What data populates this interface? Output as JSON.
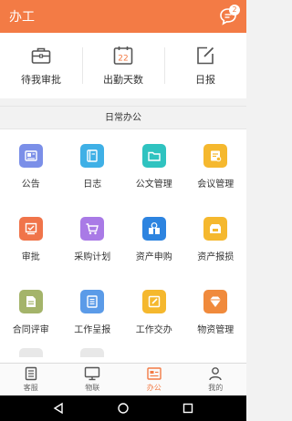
{
  "header": {
    "title": "办工",
    "chat_badge": "2",
    "color": "#f37b45"
  },
  "quick": [
    {
      "label": "待我审批",
      "icon": "briefcase-icon"
    },
    {
      "label": "出勤天数",
      "icon": "calendar-icon",
      "day": "22"
    },
    {
      "label": "日报",
      "icon": "edit-icon"
    }
  ],
  "section": {
    "title": "日常办公"
  },
  "grid": [
    {
      "label": "公告",
      "icon": "announcement-icon",
      "color": "#7b8fe8"
    },
    {
      "label": "日志",
      "icon": "journal-icon",
      "color": "#3fb0e6"
    },
    {
      "label": "公文管理",
      "icon": "folder-icon",
      "color": "#2fc3c0"
    },
    {
      "label": "会议管理",
      "icon": "meeting-icon",
      "color": "#f5b82e"
    },
    {
      "label": "审批",
      "icon": "approve-icon",
      "color": "#f0744a"
    },
    {
      "label": "采购计划",
      "icon": "cart-icon",
      "color": "#a97ae6"
    },
    {
      "label": "资产申购",
      "icon": "asset-purchase-icon",
      "color": "#2d84e0"
    },
    {
      "label": "资产报损",
      "icon": "asset-loss-icon",
      "color": "#f5b82e"
    },
    {
      "label": "合同评审",
      "icon": "contract-icon",
      "color": "#a4b46a"
    },
    {
      "label": "工作呈报",
      "icon": "report-icon",
      "color": "#5b9be8"
    },
    {
      "label": "工作交办",
      "icon": "assign-icon",
      "color": "#f5b82e"
    },
    {
      "label": "物资管理",
      "icon": "materials-icon",
      "color": "#f08a3c"
    }
  ],
  "grid_partial": [
    {
      "color": "#e8e8e8"
    },
    {
      "color": "#e8e8e8"
    }
  ],
  "tabs": [
    {
      "label": "客服",
      "icon": "customer-service-icon",
      "active": false
    },
    {
      "label": "物联",
      "icon": "monitor-icon",
      "active": false
    },
    {
      "label": "办公",
      "icon": "office-icon",
      "active": true
    },
    {
      "label": "我的",
      "icon": "user-icon",
      "active": false
    }
  ],
  "system_nav": [
    "back-icon",
    "home-icon",
    "recents-icon"
  ]
}
